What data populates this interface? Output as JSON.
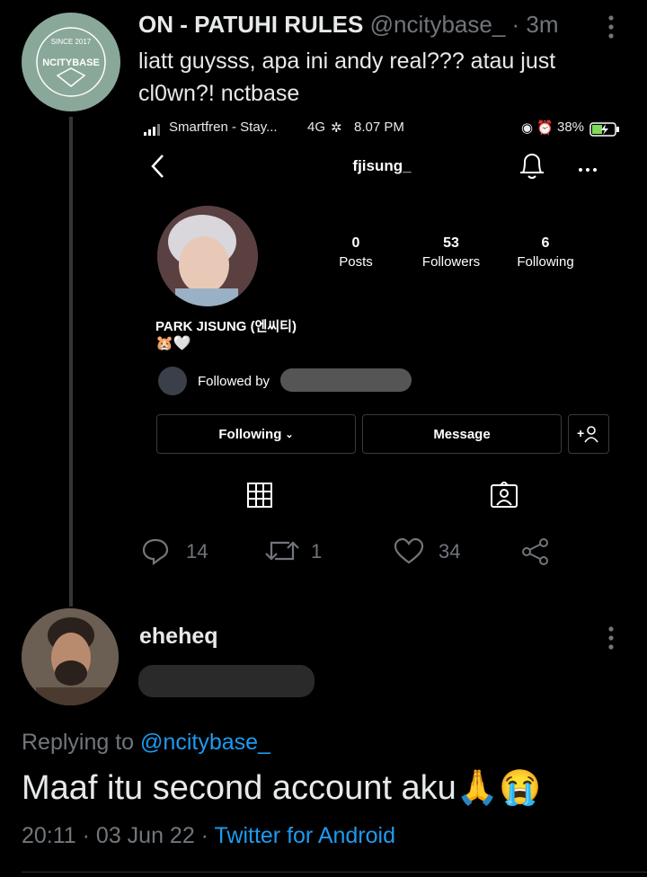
{
  "tweet": {
    "author_name": "ON - PATUHI RULES",
    "author_handle": "@ncitybase_",
    "time": "· 3m",
    "text_line1": "liatt guysss, apa ini andy real??? atau just",
    "text_line2": "cl0wn?! nctbase",
    "avatar_text_top": "SINCE 2017",
    "avatar_text": "NCITYBASE",
    "replies": "14",
    "retweets": "1",
    "likes": "34"
  },
  "phone_status": {
    "carrier": "Smartfren - Stay...",
    "network": "4G",
    "time": "8.07 PM",
    "battery": "38%"
  },
  "ig_profile": {
    "username": "fjisung_",
    "posts_count": "0",
    "posts_label": "Posts",
    "followers_count": "53",
    "followers_label": "Followers",
    "following_count": "6",
    "following_label": "Following",
    "display_name": "PARK JISUNG (엔씨티)",
    "bio_emoji": "🐹🤍",
    "followed_by": "Followed by",
    "following_button": "Following",
    "message_button": "Message"
  },
  "reply": {
    "author_name": "eheheq",
    "replying_to_prefix": "Replying to",
    "replying_to_handle": "@ncitybase_",
    "text": "Maaf itu second account aku🙏😭",
    "date": "20:11 · 03 Jun 22 ·",
    "source": "Twitter for Android"
  },
  "colors": {
    "background": "#000000",
    "text": "#e7e9ea",
    "muted": "#71767b",
    "link": "#1d9bf0",
    "avatar_bg": "#8aa89a"
  }
}
